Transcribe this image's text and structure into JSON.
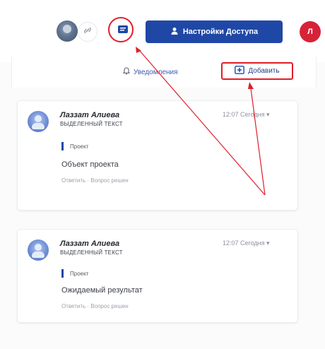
{
  "toolbar": {
    "access_button_label": "Настройки Доступа",
    "user_initial": "Л"
  },
  "subbar": {
    "notifications_label": "Уведомления",
    "add_label": "Добавить"
  },
  "comments": [
    {
      "author": "Лаззат Алиева",
      "time": "12:07 Сегодня",
      "subtitle": "ВЫДЕЛЕННЫЙ ТЕКСТ",
      "quote": "Проект",
      "text": "Объект проекта",
      "actions": "Ответить · Вопрос решен"
    },
    {
      "author": "Лаззат Алиева",
      "time": "12:07 Сегодня",
      "subtitle": "ВЫДЕЛЕННЫЙ ТЕКСТ",
      "quote": "Проект",
      "text": "Ожидаемый результат",
      "actions": "Ответить · Вопрос решен"
    }
  ],
  "colors": {
    "accent_blue": "#1f48a6",
    "annotation_red": "#e01e2a"
  },
  "icons": {
    "user_avatar": "user-avatar-icon",
    "link": "link-icon",
    "comment": "comment-icon",
    "person": "person-icon",
    "bell": "bell-icon",
    "add": "add-comment-icon",
    "chevron": "chevron-down-icon"
  }
}
